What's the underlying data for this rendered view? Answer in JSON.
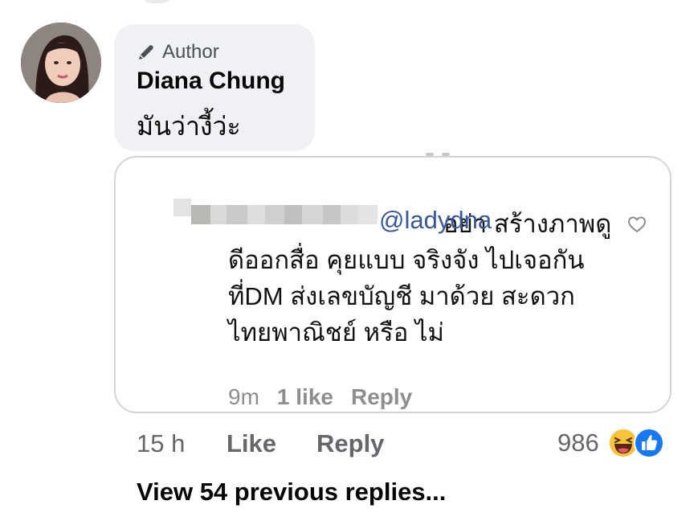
{
  "comment": {
    "author_badge": "Author",
    "commenter_name": "Diana Chung",
    "text": "มันว่างี้ว่ะ",
    "time": "15 h",
    "like_label": "Like",
    "reply_label": "Reply",
    "reaction_count": "986",
    "reaction_icons": [
      "haha-reaction",
      "like-reaction"
    ]
  },
  "embedded_reply": {
    "mention": "@ladydna",
    "text": "อย่า สร้างภาพดูดีออกสื่อ คุยแบบ จริงจัง ไปเจอกันที่DM ส่งเลขบัญชี มาด้วย สะดวกไทยพาณิชย์ หรือ ไม่",
    "time": "9m",
    "likes": "1 like",
    "reply_label": "Reply"
  },
  "view_previous_replies": "View 54 previous replies...",
  "colors": {
    "bubble_bg": "#eff1f4",
    "mention": "#385898",
    "meta_text": "#65676b",
    "like_blue": "#1877f2",
    "haha_yellow": "#f7c33b"
  }
}
